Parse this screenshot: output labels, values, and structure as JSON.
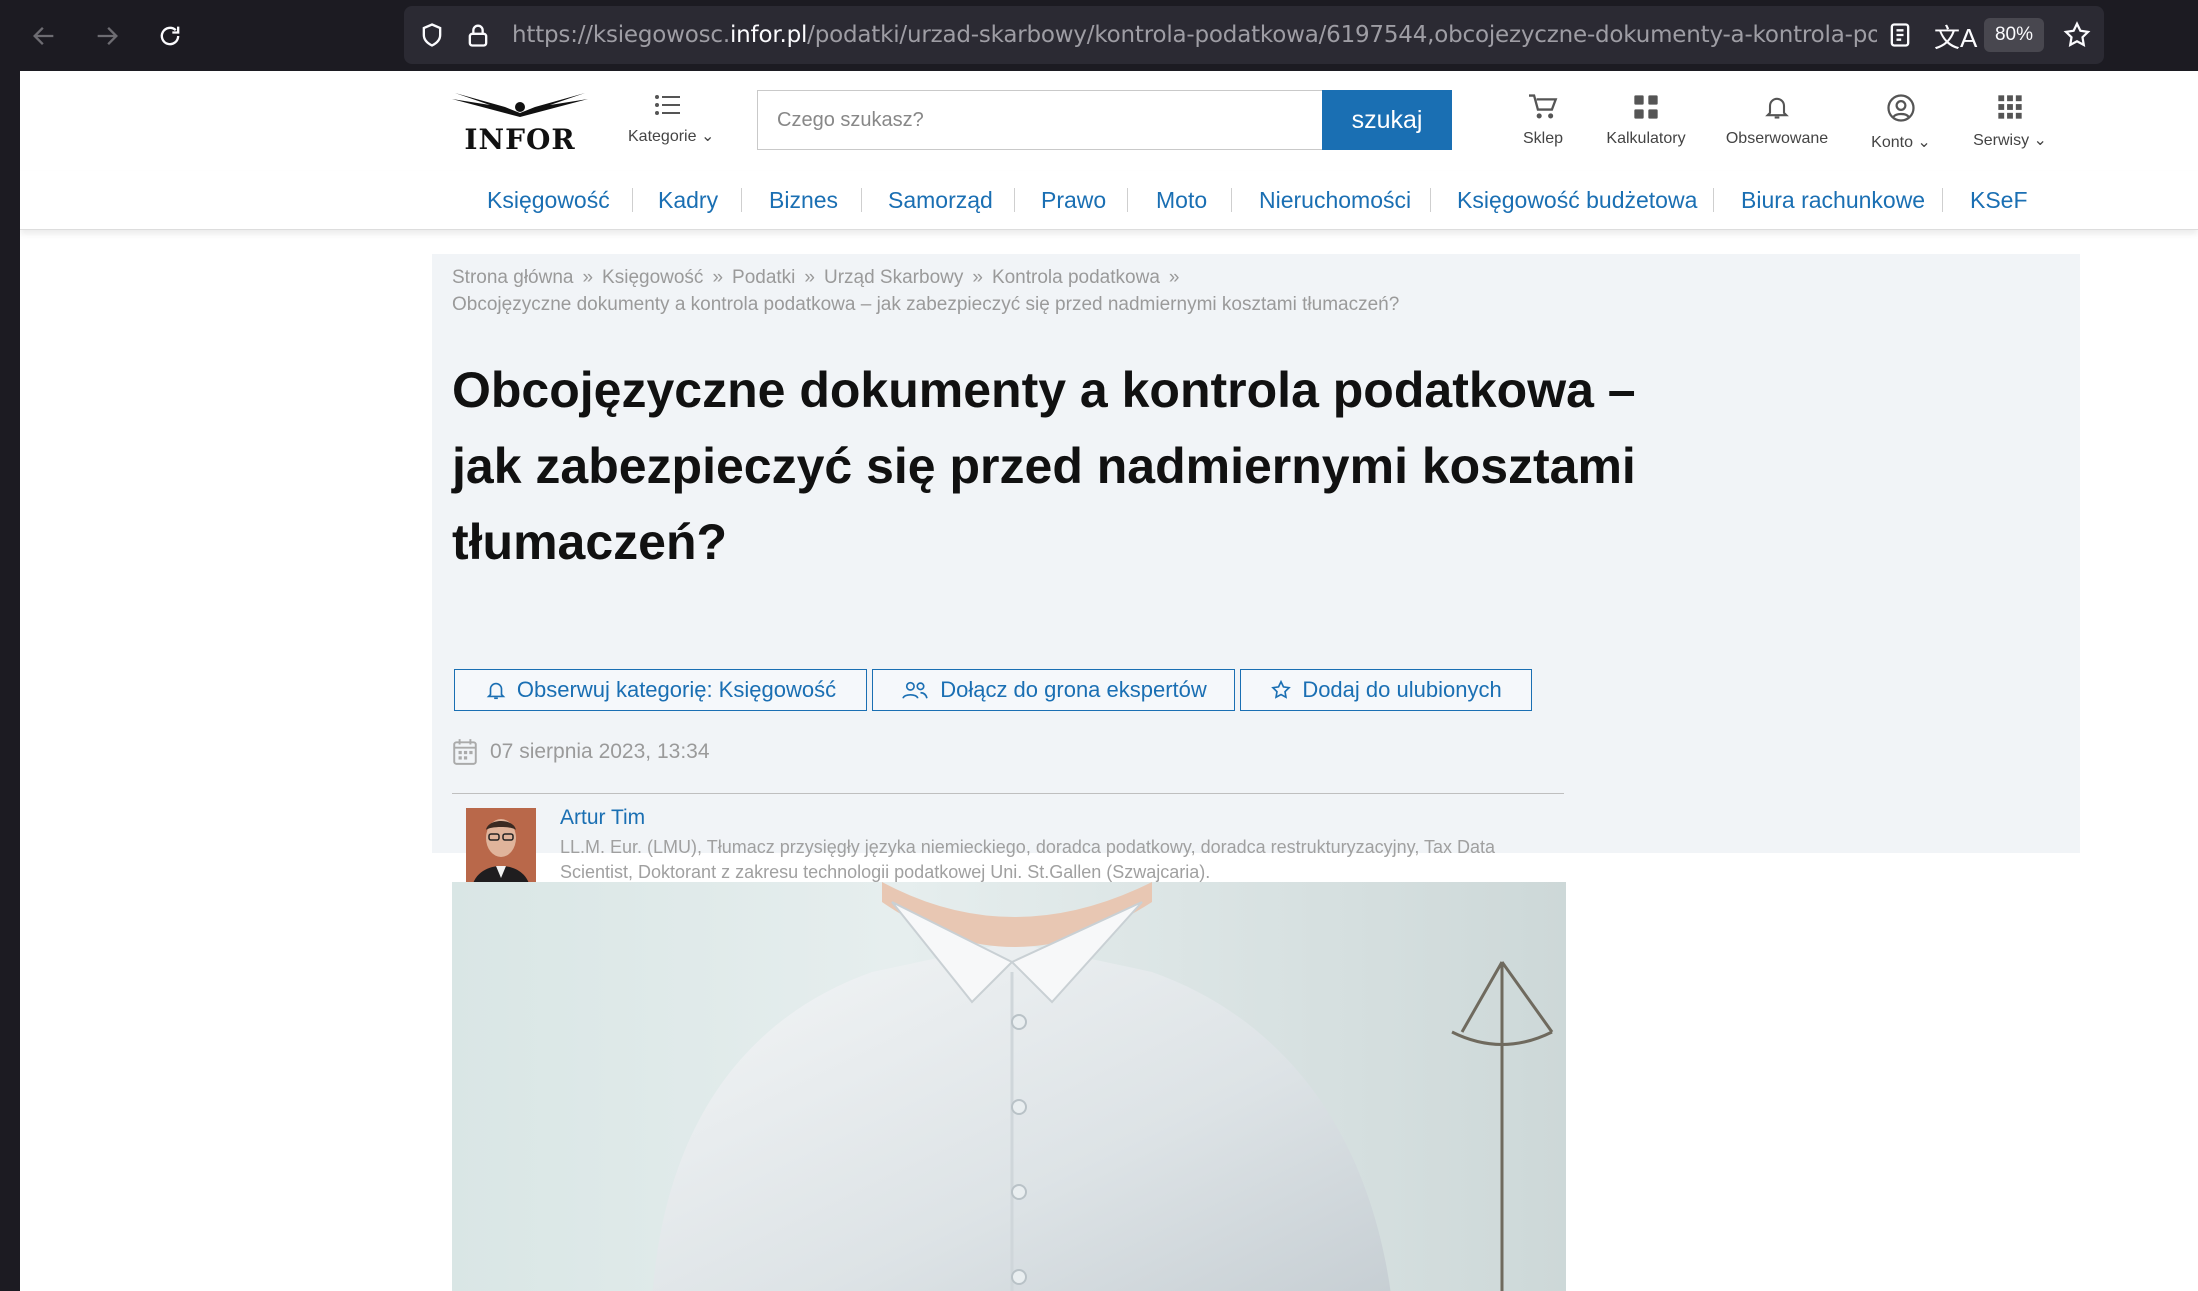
{
  "browser": {
    "url_prefix": "https://ksiegowosc.",
    "url_domain": "infor.pl",
    "url_rest": "/podatki/urzad-skarbowy/kontrola-podatkowa/6197544,obcojezyczne-dokumenty-a-kontrola-podatkowa",
    "zoom": "80%"
  },
  "header": {
    "logo_text": "INFOR",
    "kategorie_label": "Kategorie",
    "search_placeholder": "Czego szukasz?",
    "search_button": "szukaj",
    "icons": [
      {
        "label": "Sklep",
        "icon": "cart-icon"
      },
      {
        "label": "Kalkulatory",
        "icon": "grid-icon"
      },
      {
        "label": "Obserwowane",
        "icon": "bell-icon"
      },
      {
        "label": "Konto",
        "icon": "user-icon"
      },
      {
        "label": "Serwisy",
        "icon": "apps-icon"
      }
    ]
  },
  "categories": [
    "Księgowość",
    "Kadry",
    "Biznes",
    "Samorząd",
    "Prawo",
    "Moto",
    "Nieruchomości",
    "Księgowość budżetowa",
    "Biura rachunkowe",
    "KSeF"
  ],
  "breadcrumb": {
    "items": [
      "Strona główna",
      "Księgowość",
      "Podatki",
      "Urząd Skarbowy",
      "Kontrola podatkowa"
    ],
    "separator": "»",
    "current": "Obcojęzyczne dokumenty a kontrola podatkowa – jak zabezpieczyć się przed nadmiernymi kosztami tłumaczeń?"
  },
  "article": {
    "title": "Obcojęzyczne dokumenty a kontrola podatkowa – jak zabezpieczyć się przed nadmiernymi kosztami tłumaczeń?",
    "actions": {
      "follow": "Obserwuj kategorię: Księgowość",
      "experts": "Dołącz do grona ekspertów",
      "favorite": "Dodaj do ulubionych"
    },
    "date": "07 sierpnia 2023, 13:34",
    "author": {
      "name": "Artur Tim",
      "bio": "LL.M. Eur. (LMU), Tłumacz przysięgły języka niemieckiego, doradca podatkowy, doradca restrukturyzacyjny, Tax Data Scientist, Doktorant z zakresu technologii podatkowej Uni. St.Gallen (Szwajcaria)."
    }
  },
  "colors": {
    "brand_blue": "#1a6fb3",
    "hero_bg": "#f1f4f7",
    "chrome_bg": "#1c1b22"
  }
}
